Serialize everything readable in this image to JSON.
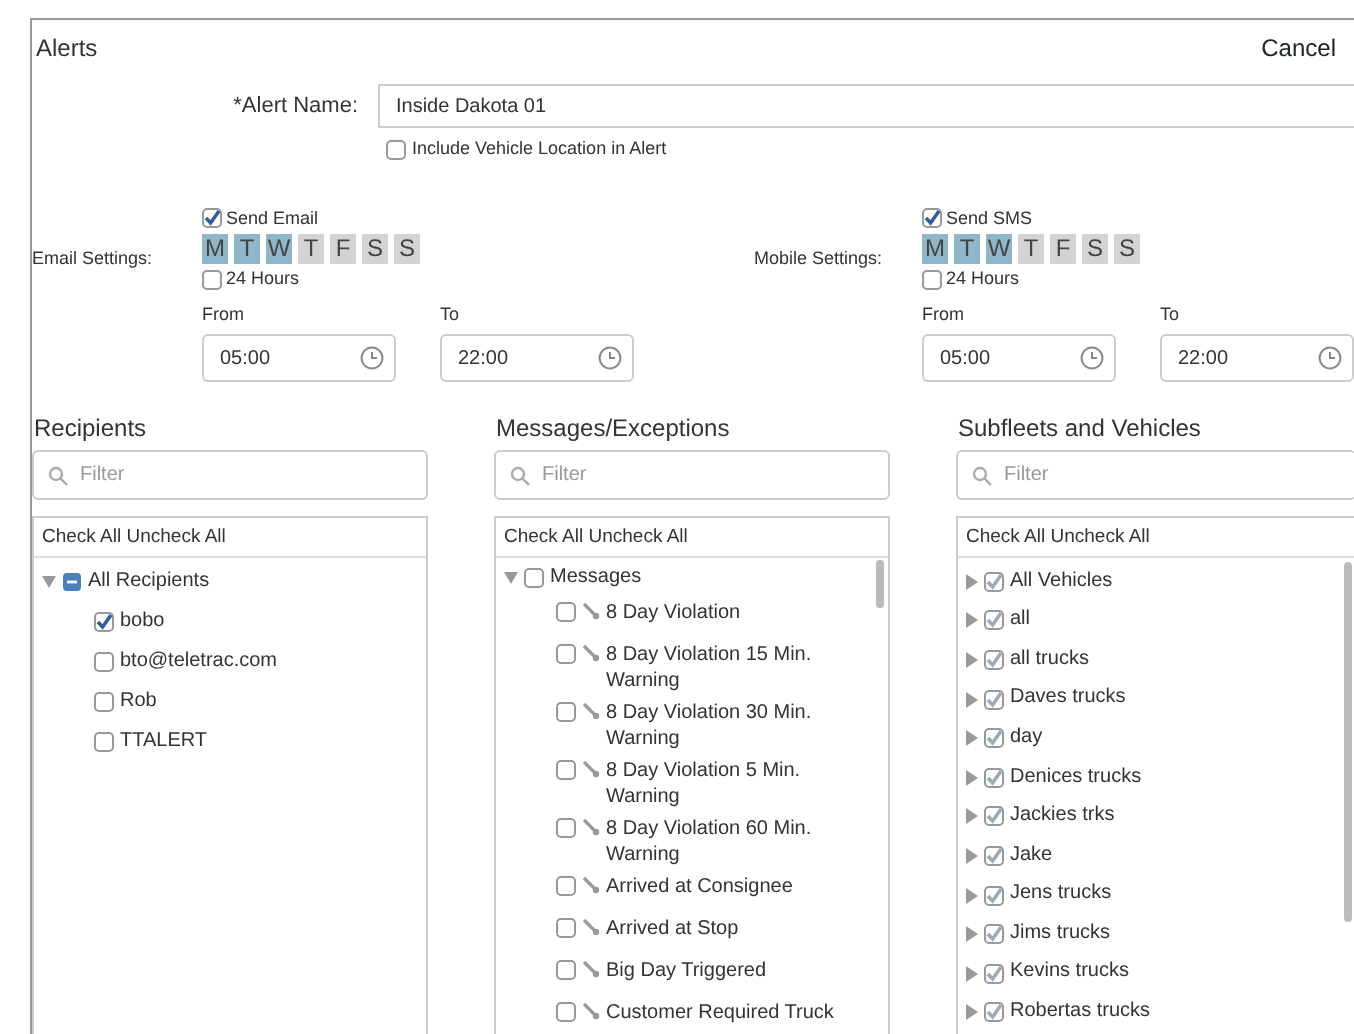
{
  "header": {
    "title": "Alerts",
    "cancel": "Cancel"
  },
  "alert_name": {
    "label": "*Alert Name:",
    "value": "Inside Dakota 01"
  },
  "include_location": {
    "label": "Include Vehicle Location in Alert",
    "checked": false
  },
  "settings": [
    {
      "label": "Email Settings:",
      "send": {
        "label": "Send Email",
        "checked": true
      },
      "days": [
        {
          "label": "M",
          "selected": true
        },
        {
          "label": "T",
          "selected": true
        },
        {
          "label": "W",
          "selected": true
        },
        {
          "label": "T",
          "selected": false
        },
        {
          "label": "F",
          "selected": false
        },
        {
          "label": "S",
          "selected": false
        },
        {
          "label": "S",
          "selected": false
        }
      ],
      "all_day": {
        "label": "24 Hours",
        "checked": false
      },
      "from": {
        "label": "From",
        "value": "05:00"
      },
      "to": {
        "label": "To",
        "value": "22:00"
      }
    },
    {
      "label": "Mobile Settings:",
      "send": {
        "label": "Send SMS",
        "checked": true
      },
      "days": [
        {
          "label": "M",
          "selected": true
        },
        {
          "label": "T",
          "selected": true
        },
        {
          "label": "W",
          "selected": true
        },
        {
          "label": "T",
          "selected": false
        },
        {
          "label": "F",
          "selected": false
        },
        {
          "label": "S",
          "selected": false
        },
        {
          "label": "S",
          "selected": false
        }
      ],
      "all_day": {
        "label": "24 Hours",
        "checked": false
      },
      "from": {
        "label": "From",
        "value": "05:00"
      },
      "to": {
        "label": "To",
        "value": "22:00"
      }
    }
  ],
  "panels": [
    {
      "title": "Recipients",
      "filter": {
        "placeholder": "Filter"
      },
      "check_all": "Check All",
      "uncheck_all": "Uncheck All",
      "items": [
        {
          "label": "All Recipients",
          "expanded": true,
          "partial": true,
          "children": [
            {
              "label": "bobo",
              "checked": true
            },
            {
              "label": "bto@teletrac.com",
              "checked": false
            },
            {
              "label": "Rob",
              "checked": false
            },
            {
              "label": "TTALERT",
              "checked": false
            }
          ]
        }
      ]
    },
    {
      "title": "Messages/Exceptions",
      "filter": {
        "placeholder": "Filter"
      },
      "check_all": "Check All",
      "uncheck_all": "Uncheck All",
      "items": [
        {
          "label": "Messages",
          "expanded": true,
          "checked": false,
          "children": [
            {
              "label": "8 Day Violation",
              "checked": false,
              "kind": "pin"
            },
            {
              "label": "8 Day Violation 15 Min. Warning",
              "checked": false,
              "kind": "pin"
            },
            {
              "label": "8 Day Violation 30 Min. Warning",
              "checked": false,
              "kind": "pin"
            },
            {
              "label": "8 Day Violation 5 Min. Warning",
              "checked": false,
              "kind": "pin"
            },
            {
              "label": "8 Day Violation 60 Min. Warning",
              "checked": false,
              "kind": "pin"
            },
            {
              "label": "Arrived at Consignee",
              "checked": false,
              "kind": "pin"
            },
            {
              "label": "Arrived at Stop",
              "checked": false,
              "kind": "pin"
            },
            {
              "label": "Big Day Triggered",
              "checked": false,
              "kind": "pin"
            },
            {
              "label": "Customer Required Truck",
              "checked": false,
              "kind": "pin"
            }
          ]
        }
      ]
    },
    {
      "title": "Subfleets and Vehicles",
      "filter": {
        "placeholder": "Filter"
      },
      "check_all": "Check All",
      "uncheck_all": "Uncheck All",
      "items": [
        {
          "label": "All Vehicles",
          "expanded": false,
          "checked": true
        },
        {
          "label": "all",
          "expanded": false,
          "checked": true
        },
        {
          "label": "all trucks",
          "expanded": false,
          "checked": true
        },
        {
          "label": "Daves trucks",
          "expanded": false,
          "checked": true
        },
        {
          "label": "day",
          "expanded": false,
          "checked": true
        },
        {
          "label": "Denices trucks",
          "expanded": false,
          "checked": true
        },
        {
          "label": "Jackies trks",
          "expanded": false,
          "checked": true
        },
        {
          "label": "Jake",
          "expanded": false,
          "checked": true
        },
        {
          "label": "Jens trucks",
          "expanded": false,
          "checked": true
        },
        {
          "label": "Jims trucks",
          "expanded": false,
          "checked": true
        },
        {
          "label": "Kevins trucks",
          "expanded": false,
          "checked": true
        },
        {
          "label": "Robertas trucks",
          "expanded": false,
          "checked": true
        }
      ]
    }
  ]
}
